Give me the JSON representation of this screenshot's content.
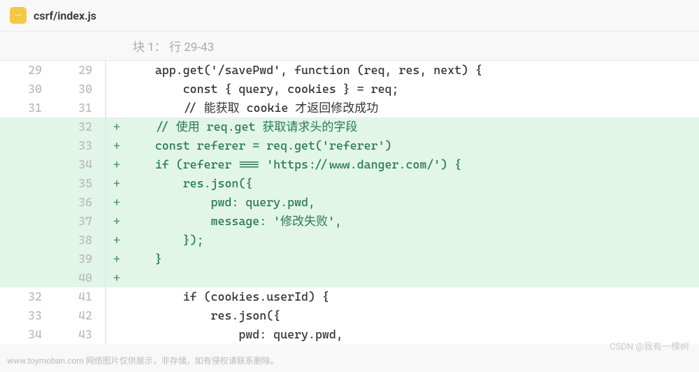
{
  "file": {
    "path": "csrf/index.js",
    "icon": "···"
  },
  "hunk": {
    "label": "块 1： 行 29-43"
  },
  "lines": [
    {
      "old": "29",
      "new": "29",
      "marker": "",
      "added": false,
      "code": "    app.get('/savePwd', function (req, res, next) {"
    },
    {
      "old": "30",
      "new": "30",
      "marker": "",
      "added": false,
      "code": "        const { query, cookies } = req;"
    },
    {
      "old": "31",
      "new": "31",
      "marker": "",
      "added": false,
      "code": "        // 能获取 cookie 才返回修改成功"
    },
    {
      "old": "",
      "new": "32",
      "marker": "+",
      "added": true,
      "code": "    // 使用 req.get 获取请求头的字段"
    },
    {
      "old": "",
      "new": "33",
      "marker": "+",
      "added": true,
      "code": "    const referer = req.get('referer')"
    },
    {
      "old": "",
      "new": "34",
      "marker": "+",
      "added": true,
      "code": "    if (referer === 'https://www.danger.com/') {"
    },
    {
      "old": "",
      "new": "35",
      "marker": "+",
      "added": true,
      "code": "        res.json({"
    },
    {
      "old": "",
      "new": "36",
      "marker": "+",
      "added": true,
      "code": "            pwd: query.pwd,"
    },
    {
      "old": "",
      "new": "37",
      "marker": "+",
      "added": true,
      "code": "            message: '修改失败',"
    },
    {
      "old": "",
      "new": "38",
      "marker": "+",
      "added": true,
      "code": "        });"
    },
    {
      "old": "",
      "new": "39",
      "marker": "+",
      "added": true,
      "code": "    }"
    },
    {
      "old": "",
      "new": "40",
      "marker": "+",
      "added": true,
      "code": ""
    },
    {
      "old": "32",
      "new": "41",
      "marker": "",
      "added": false,
      "code": "        if (cookies.userId) {"
    },
    {
      "old": "33",
      "new": "42",
      "marker": "",
      "added": false,
      "code": "            res.json({"
    },
    {
      "old": "34",
      "new": "43",
      "marker": "",
      "added": false,
      "code": "                pwd: query.pwd,"
    }
  ],
  "watermark": "CSDN @我有一棵树",
  "footer": "www.toymoban.com 网络图片仅供展示，非存储，如有侵权请联系删除。"
}
